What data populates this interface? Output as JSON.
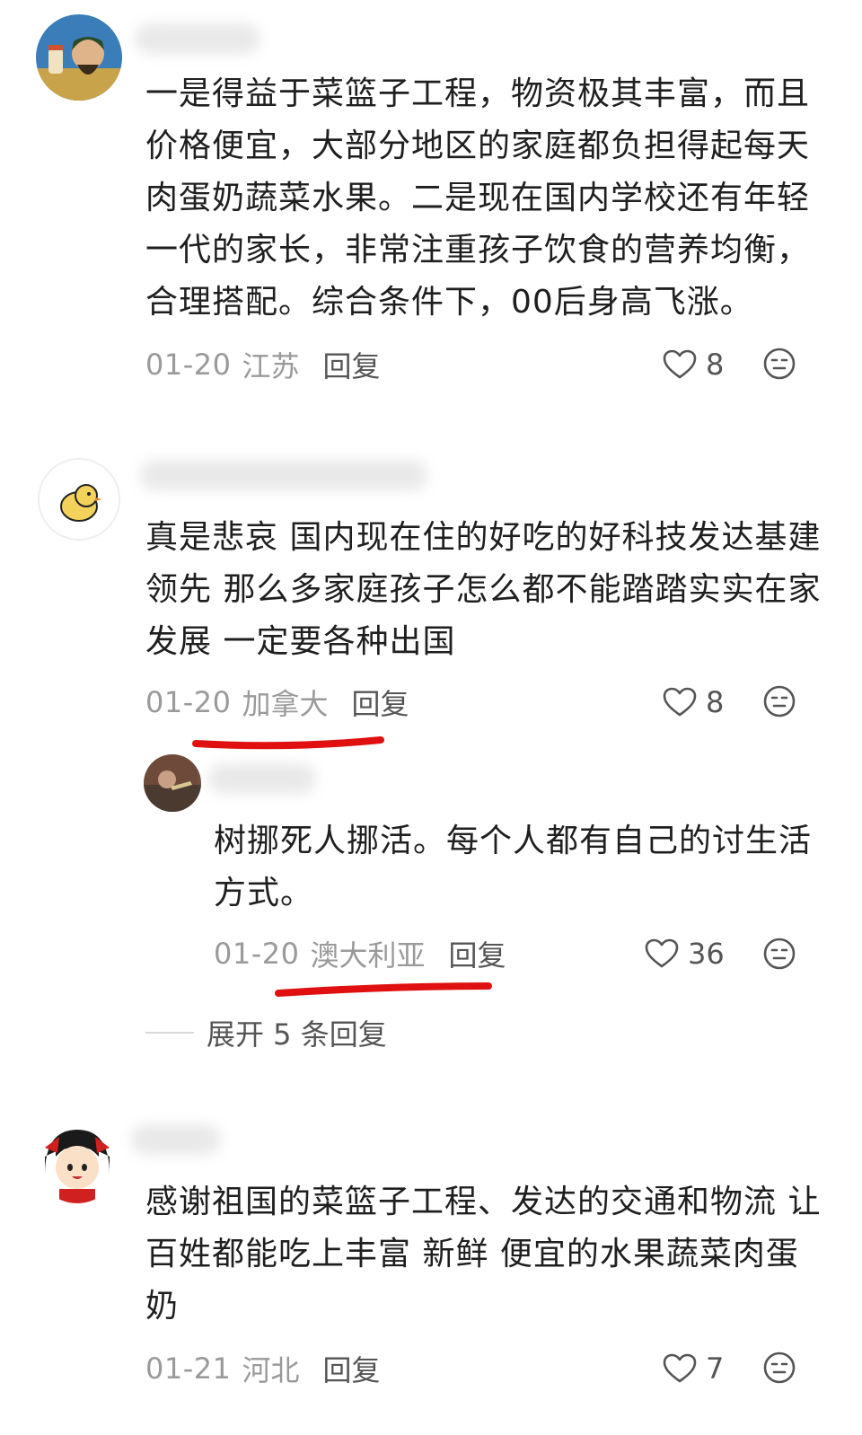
{
  "comments": [
    {
      "text": "一是得益于菜篮子工程，物资极其丰富，而且价格便宜，大部分地区的家庭都负担得起每天肉蛋奶蔬菜水果。二是现在国内学校还有年轻一代的家长，非常注重孩子饮食的营养均衡，合理搭配。综合条件下，00后身高飞涨。",
      "lines": [
        "一是得益于菜篮子工程，物资极其丰富，而且",
        "价格便宜，大部分地区的家庭都负担得起每天",
        "肉蛋奶蔬菜水果。二是现在国内学校还有年轻",
        "一代的家长，非常注重孩子饮食的营养均衡，",
        "合理搭配。综合条件下，00后身高飞涨。"
      ],
      "date": "01-20",
      "location": "江苏",
      "reply_label": "回复",
      "likes": "8"
    },
    {
      "lines": [
        "真是悲哀 国内现在住的好吃的好科技发达基建",
        "领先 那么多家庭孩子怎么都不能踏踏实实在家",
        "发展 一定要各种出国"
      ],
      "date": "01-20",
      "location": "加拿大",
      "reply_label": "回复",
      "likes": "8",
      "sub_reply": {
        "lines": [
          "树挪死人挪活。每个人都有自己的讨生活",
          "方式。"
        ],
        "date": "01-20",
        "location": "澳大利亚",
        "reply_label": "回复",
        "likes": "36"
      },
      "expand_label": "展开 5 条回复"
    },
    {
      "lines": [
        "感谢祖国的菜篮子工程、发达的交通和物流 让",
        "百姓都能吃上丰富 新鲜 便宜的水果蔬菜肉蛋",
        "奶"
      ],
      "date": "01-21",
      "location": "河北",
      "reply_label": "回复",
      "likes": "7"
    }
  ],
  "icons": {
    "like": "heart-outline-icon",
    "dislike": "unhappy-face-icon"
  },
  "colors": {
    "annotation_underline": "#e01010",
    "meta_gray": "#9a9a9a"
  }
}
